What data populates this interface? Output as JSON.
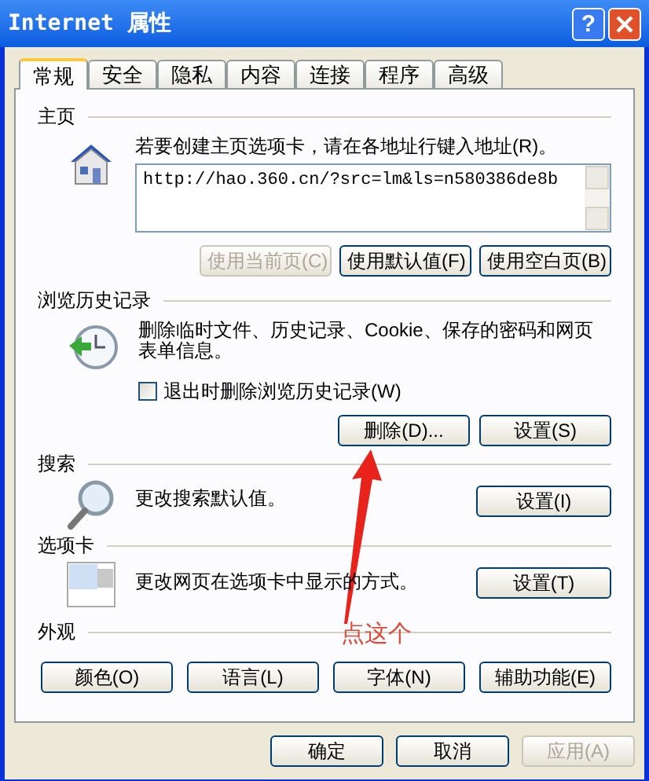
{
  "window": {
    "title": "Internet 属性",
    "help": "?"
  },
  "tabs": [
    {
      "label": "常规",
      "selected": true
    },
    {
      "label": "安全",
      "selected": false
    },
    {
      "label": "隐私",
      "selected": false
    },
    {
      "label": "内容",
      "selected": false
    },
    {
      "label": "连接",
      "selected": false
    },
    {
      "label": "程序",
      "selected": false
    },
    {
      "label": "高级",
      "selected": false
    }
  ],
  "homepage": {
    "title": "主页",
    "description": "若要创建主页选项卡，请在各地址行键入地址(R)。",
    "url": "http://hao.360.cn/?src=lm&ls=n580386de8b",
    "buttons": [
      {
        "label": "使用当前页(C)",
        "disabled": true
      },
      {
        "label": "使用默认值(F)",
        "disabled": false
      },
      {
        "label": "使用空白页(B)",
        "disabled": false
      }
    ]
  },
  "history": {
    "title": "浏览历史记录",
    "description": "删除临时文件、历史记录、Cookie、保存的密码和网页表单信息。",
    "checkbox": {
      "label": "退出时删除浏览历史记录(W)",
      "checked": false
    },
    "buttons": [
      {
        "label": "删除(D)...",
        "disabled": false
      },
      {
        "label": "设置(S)",
        "disabled": false
      }
    ]
  },
  "search": {
    "title": "搜索",
    "description": "更改搜索默认值。",
    "buttons": [
      {
        "label": "设置(I)",
        "disabled": false
      }
    ]
  },
  "tab_settings": {
    "title": "选项卡",
    "description": "更改网页在选项卡中显示的方式。",
    "buttons": [
      {
        "label": "设置(T)",
        "disabled": false
      }
    ]
  },
  "appearance": {
    "title": "外观",
    "buttons": [
      {
        "label": "颜色(O)",
        "disabled": false
      },
      {
        "label": "语言(L)",
        "disabled": false
      },
      {
        "label": "字体(N)",
        "disabled": false
      },
      {
        "label": "辅助功能(E)",
        "disabled": false
      }
    ]
  },
  "annotation": {
    "label": "点这个"
  },
  "footer_buttons": [
    {
      "label": "确定",
      "disabled": false
    },
    {
      "label": "取消",
      "disabled": false
    },
    {
      "label": "应用(A)",
      "disabled": true
    }
  ]
}
